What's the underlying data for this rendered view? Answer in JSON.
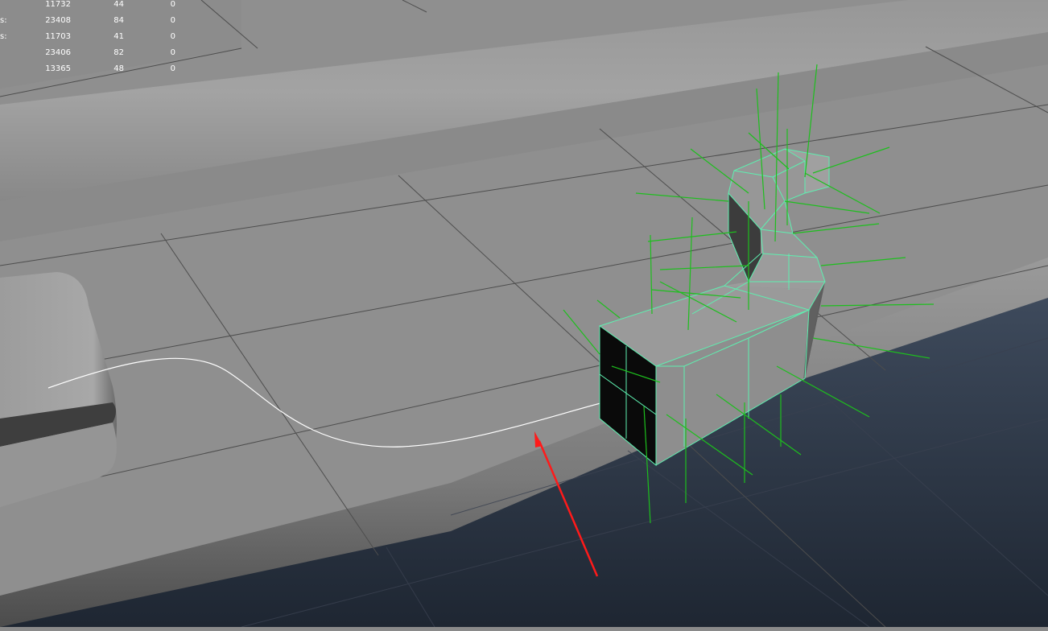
{
  "viewport": {
    "heads_up_display": {
      "rows": [
        {
          "label": "",
          "col1": "11732",
          "col2": "44",
          "col3": "0"
        },
        {
          "label": "s:",
          "col1": "23408",
          "col2": "84",
          "col3": "0"
        },
        {
          "label": "s:",
          "col1": "11703",
          "col2": "41",
          "col3": "0"
        },
        {
          "label": "",
          "col1": "23406",
          "col2": "82",
          "col3": "0"
        },
        {
          "label": "",
          "col1": "13365",
          "col2": "48",
          "col3": "0"
        }
      ]
    },
    "colors": {
      "grid_line": "#4a4a4a",
      "wireframe": "#6ff0c0",
      "normals": "#1fbf1f",
      "curve": "#ffffff",
      "annotation_arrow": "#ff0000",
      "background_top": "#5a6a80",
      "background_bottom": "#1f2733"
    }
  }
}
